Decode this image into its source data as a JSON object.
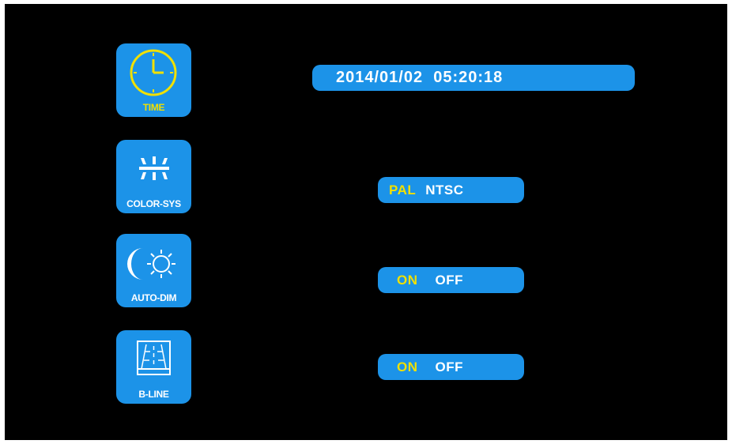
{
  "menu": {
    "time": {
      "label": "TIME",
      "icon": "clock-icon"
    },
    "color_sys": {
      "label": "COLOR-SYS",
      "icon": "color-system-icon"
    },
    "auto_dim": {
      "label": "AUTO-DIM",
      "icon": "moon-sun-icon"
    },
    "b_line": {
      "label": "B-LINE",
      "icon": "parking-guideline-icon"
    }
  },
  "time_setting": {
    "datetime": "2014/01/02  05:20:18"
  },
  "color_sys_setting": {
    "options": [
      "PAL",
      "NTSC"
    ],
    "selected": "PAL"
  },
  "auto_dim_setting": {
    "options": [
      "ON",
      "OFF"
    ],
    "selected": "ON"
  },
  "b_line_setting": {
    "options": [
      "ON",
      "OFF"
    ],
    "selected": "ON"
  },
  "colors": {
    "background": "#000000",
    "accent_blue": "#1c93e8",
    "highlight_yellow": "#f0e000",
    "text_white": "#ffffff"
  }
}
